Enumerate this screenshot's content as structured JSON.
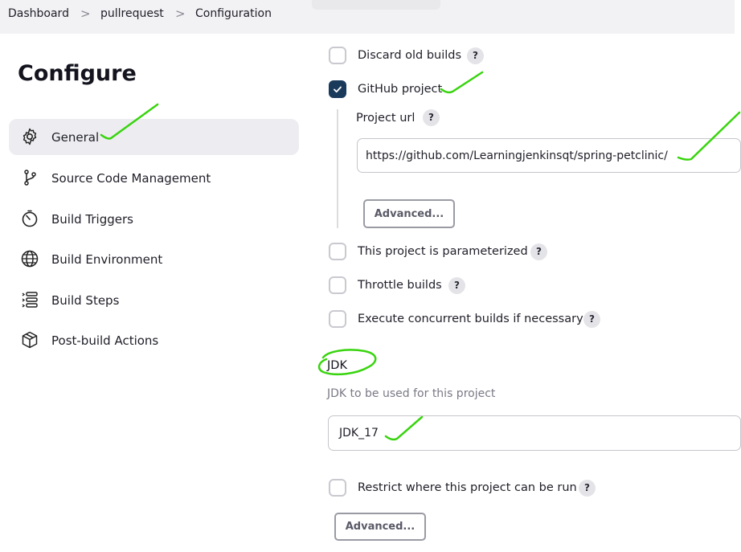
{
  "breadcrumb": {
    "items": [
      "Dashboard",
      "pullrequest",
      "Configuration"
    ],
    "separator": ">"
  },
  "page": {
    "title": "Configure"
  },
  "sidebar": {
    "items": [
      {
        "label": "General",
        "icon": "gear-icon",
        "active": true
      },
      {
        "label": "Source Code Management",
        "icon": "branch-icon"
      },
      {
        "label": "Build Triggers",
        "icon": "timer-icon"
      },
      {
        "label": "Build Environment",
        "icon": "globe-icon"
      },
      {
        "label": "Build Steps",
        "icon": "list-icon"
      },
      {
        "label": "Post-build Actions",
        "icon": "package-icon"
      }
    ]
  },
  "general": {
    "discard_old_builds": {
      "label": "Discard old builds",
      "checked": false,
      "help": "?"
    },
    "github_project": {
      "label": "GitHub project",
      "checked": true,
      "help": "?",
      "project_url_label": "Project url",
      "project_url_help": "?",
      "project_url_value": "https://github.com/Learningjenkinsqt/spring-petclinic/",
      "advanced_label": "Advanced..."
    },
    "parameterized": {
      "label": "This project is parameterized",
      "checked": false,
      "help": "?"
    },
    "throttle_builds": {
      "label": "Throttle builds",
      "checked": false,
      "help": "?"
    },
    "concurrent_builds": {
      "label": "Execute concurrent builds if necessary",
      "checked": false,
      "help": "?"
    },
    "jdk": {
      "title": "JDK",
      "description": "JDK to be used for this project",
      "selected": "JDK_17"
    },
    "restrict": {
      "label": "Restrict where this project can be run",
      "checked": false,
      "help": "?"
    },
    "advanced_label": "Advanced..."
  },
  "colors": {
    "accent_checkbox": "#1a3a5c",
    "annotation_green": "#39d40f",
    "active_sidebar_bg": "#ededf1"
  }
}
